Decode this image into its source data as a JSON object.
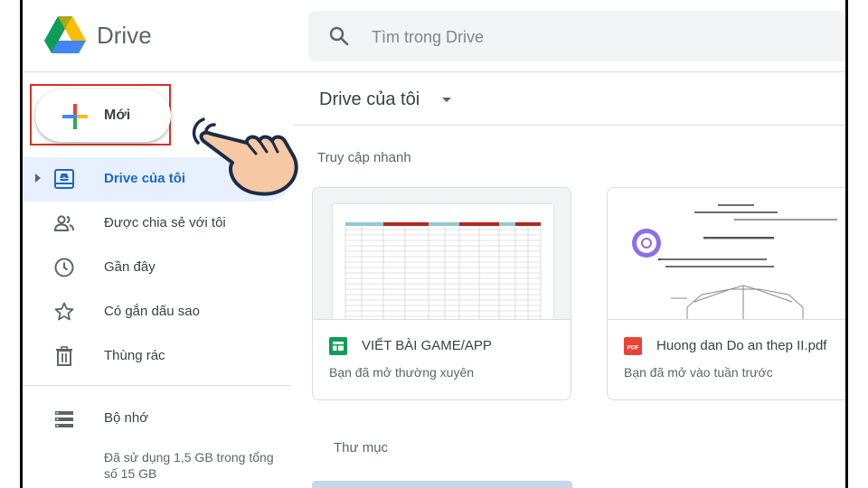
{
  "app": {
    "name": "Drive",
    "logo_icon": "google-drive-logo-icon"
  },
  "search": {
    "placeholder": "Tìm trong Drive",
    "icon": "search-icon"
  },
  "sidebar": {
    "new_button": {
      "label": "Mới",
      "icon": "plus-icon",
      "highlight_color": "#d93025"
    },
    "items": [
      {
        "label": "Drive của tôi",
        "icon": "my-drive-icon",
        "active": true
      },
      {
        "label": "Được chia sẻ với tôi",
        "icon": "shared-people-icon",
        "active": false
      },
      {
        "label": "Gần đây",
        "icon": "clock-icon",
        "active": false
      },
      {
        "label": "Có gắn dấu sao",
        "icon": "star-icon",
        "active": false
      },
      {
        "label": "Thùng rác",
        "icon": "trash-icon",
        "active": false
      }
    ],
    "storage": {
      "label": "Bộ nhớ",
      "icon": "storage-icon",
      "usage": "Đã sử dụng 1,5 GB trong tổng số 15 GB"
    }
  },
  "main": {
    "title": "Drive của tôi",
    "quick_access": {
      "title": "Truy cập nhanh",
      "files": [
        {
          "name": "VIẾT BÀI GAME/APP",
          "subtitle": "Bạn đã mở thường xuyên",
          "type": "sheets",
          "icon": "google-sheets-icon",
          "color": "#0f9d58"
        },
        {
          "name": "Huong dan Do an thep II.pdf",
          "subtitle": "Bạn đã mở vào tuần trước",
          "type": "pdf",
          "icon": "pdf-icon",
          "color": "#ea4335"
        }
      ]
    },
    "folders_title": "Thư mục"
  },
  "colors": {
    "active_bg": "#e8f0fe",
    "active_text": "#1967d2",
    "search_bg": "#f1f3f4"
  }
}
